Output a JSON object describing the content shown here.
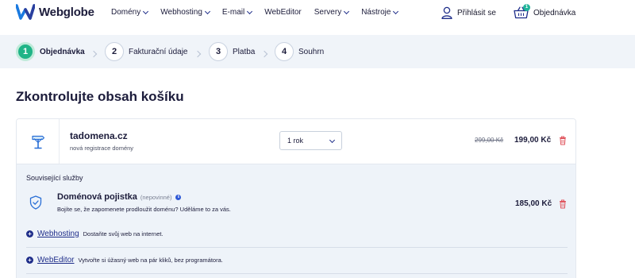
{
  "header": {
    "logo_text": "Webglobe",
    "nav": [
      {
        "label": "Domény",
        "dropdown": true
      },
      {
        "label": "Webhosting",
        "dropdown": true
      },
      {
        "label": "E-mail",
        "dropdown": true
      },
      {
        "label": "WebEditor",
        "dropdown": false
      },
      {
        "label": "Servery",
        "dropdown": true
      },
      {
        "label": "Nástroje",
        "dropdown": true
      }
    ],
    "login_label": "Přihlásit se",
    "order_label": "Objednávka",
    "cart_count": "1"
  },
  "steps": [
    {
      "num": "1",
      "label": "Objednávka",
      "active": true
    },
    {
      "num": "2",
      "label": "Fakturační údaje",
      "active": false
    },
    {
      "num": "3",
      "label": "Platba",
      "active": false
    },
    {
      "num": "4",
      "label": "Souhrn",
      "active": false
    }
  ],
  "page_title": "Zkontrolujte obsah košíku",
  "cart_item": {
    "domain": "tadomena.cz",
    "subtitle": "nová registrace domény",
    "period_selected": "1 rok",
    "old_price": "299,00 Kč",
    "price": "199,00 Kč"
  },
  "related": {
    "title": "Související služby",
    "insurance": {
      "title": "Doménová pojistka",
      "optional": "(nepovinné)",
      "info_glyph": "i",
      "description": "Bojíte se, že zapomenete prodloužit doménu? Uděláme to za vás.",
      "price": "185,00 Kč"
    },
    "services": [
      {
        "link": "Webhosting",
        "description": "Dostaňte svůj web na internet."
      },
      {
        "link": "WebEditor",
        "description": "Vytvořte si úžasný web na pár kliků, bez programátora."
      }
    ],
    "plus_glyph": "+"
  },
  "colors": {
    "brand_navy": "#1f2e8a",
    "accent_green": "#1fb487",
    "trash_red": "#e0555e"
  }
}
